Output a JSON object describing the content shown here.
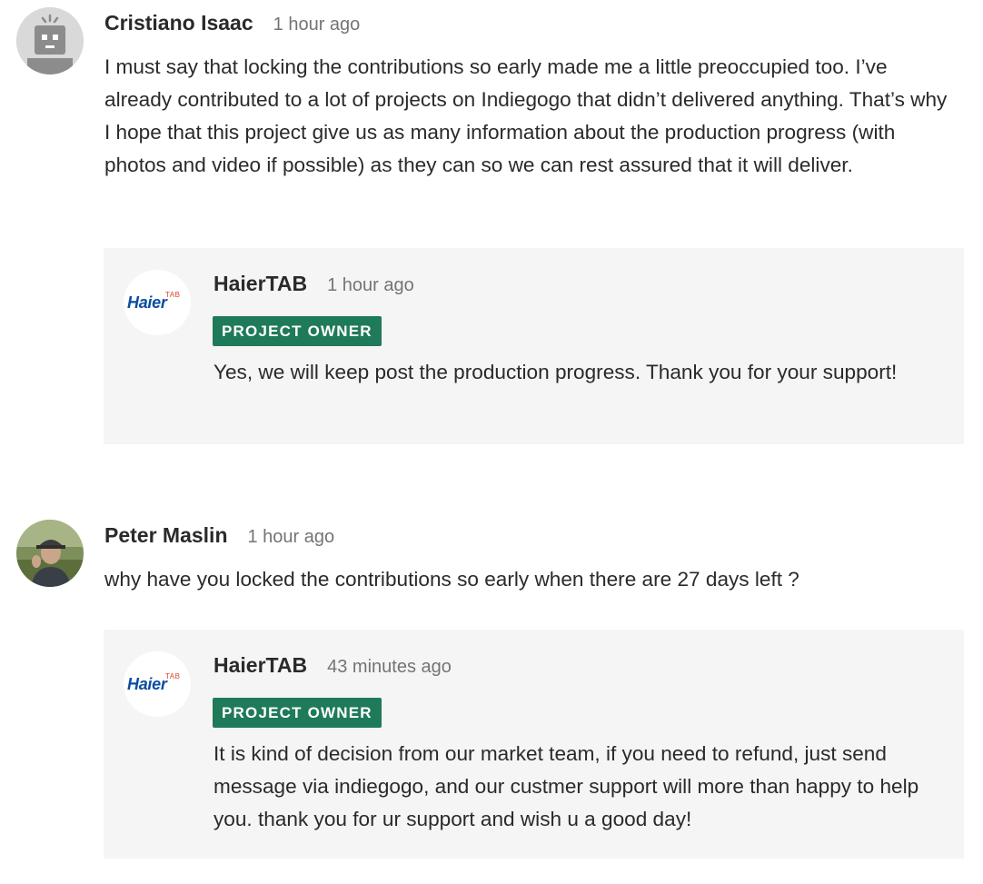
{
  "comments": [
    {
      "author": "Cristiano Isaac",
      "time": "1 hour ago",
      "avatar_icon": "default-robot-avatar",
      "text": "I must say that locking the contributions so early made me a little preoccupied too. I’ve already contributed to a lot of projects on Indiegogo that didn’t delivered anything. That’s why I hope that this project give us as many information about the production progress (with photos and video if possible) as they can so we can rest assured that it will deliver.",
      "reply": {
        "author": "HaierTAB",
        "time": "1 hour ago",
        "badge": "PROJECT OWNER",
        "logo_main": "Haier",
        "logo_sub": "TAB",
        "text": "Yes, we will keep post the production progress. Thank you for your support!"
      }
    },
    {
      "author": "Peter Maslin",
      "time": "1 hour ago",
      "avatar_icon": "user-photo-avatar",
      "text": "why have you locked the contributions so early when there are 27 days left ?",
      "reply": {
        "author": "HaierTAB",
        "time": "43 minutes ago",
        "badge": "PROJECT OWNER",
        "logo_main": "Haier",
        "logo_sub": "TAB",
        "text": "It is kind of decision from our market team, if you need to refund, just send message via indiegogo, and our custmer support will more than happy to help you. thank you for ur support and wish u a good day!"
      }
    }
  ],
  "colors": {
    "owner_badge": "#1f7a5a",
    "reply_background": "#f5f5f5",
    "timestamp": "#747474",
    "text": "#2a2a2a",
    "logo_blue": "#0a4da2",
    "logo_red": "#e1402c"
  }
}
